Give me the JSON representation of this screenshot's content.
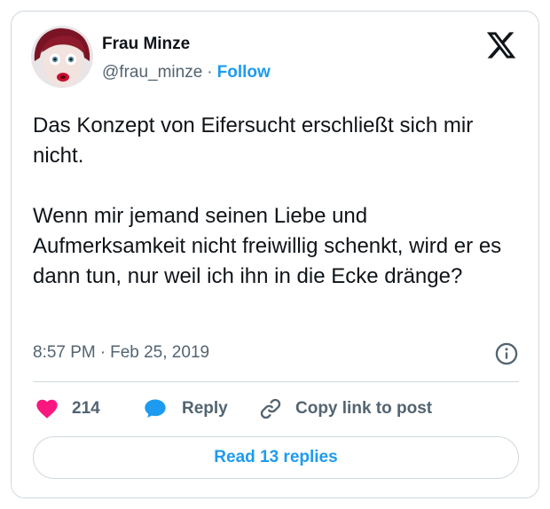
{
  "author": {
    "name": "Frau Minze",
    "handle": "@frau_minze",
    "separator": "·",
    "follow_label": "Follow"
  },
  "tweet": {
    "text": "Das Konzept von Eifersucht erschließt sich mir nicht.\n\nWenn mir jemand seinen Liebe und Aufmerksamkeit nicht freiwillig schenkt, wird er es dann tun, nur weil ich ihn in die Ecke dränge?",
    "time": "8:57 PM",
    "separator": "·",
    "date": "Feb 25, 2019"
  },
  "actions": {
    "like_count": "214",
    "reply_label": "Reply",
    "copy_link_label": "Copy link to post"
  },
  "read_replies_label": "Read 13 replies",
  "icons": {
    "platform": "x-logo-icon",
    "info": "info-icon",
    "like": "heart-icon",
    "reply": "speech-bubble-icon",
    "copy_link": "link-icon"
  },
  "colors": {
    "accent": "#1d9bf0",
    "like": "#f91880",
    "secondary_text": "#536471",
    "border": "#cfd9de"
  }
}
